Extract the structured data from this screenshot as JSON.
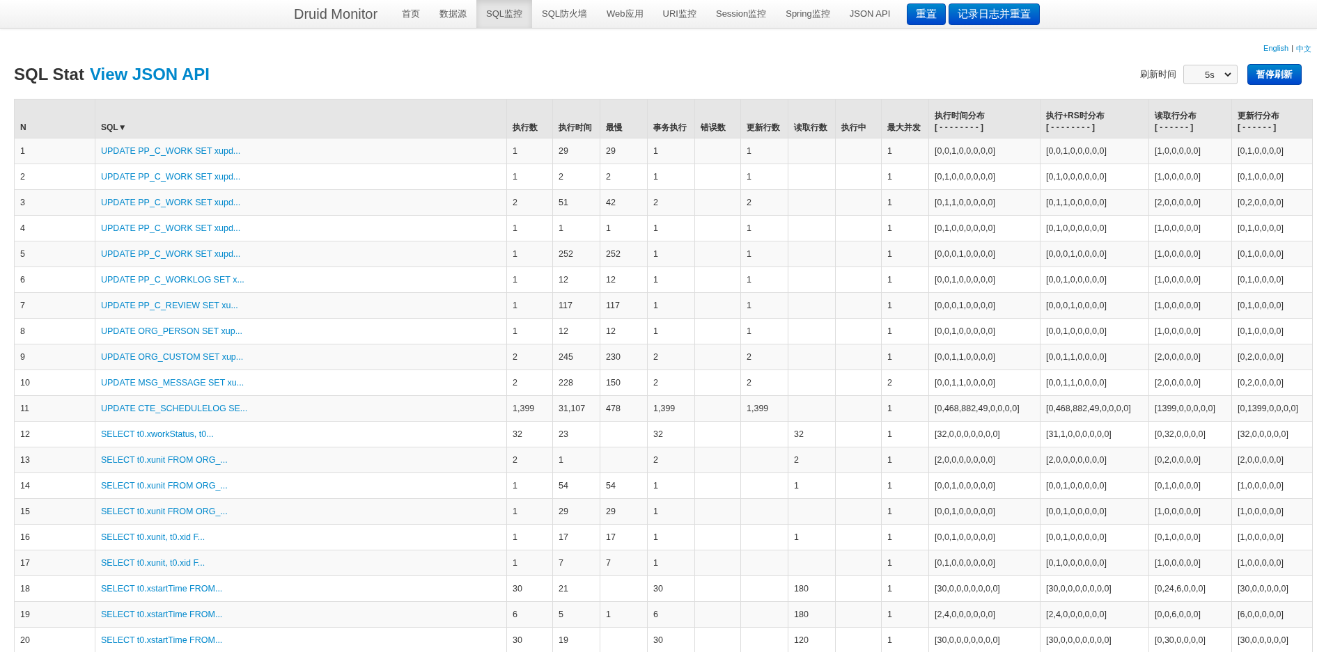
{
  "navbar": {
    "brand": "Druid Monitor",
    "items": [
      {
        "label": "首页",
        "selected": false
      },
      {
        "label": "数据源",
        "selected": false
      },
      {
        "label": "SQL监控",
        "selected": true
      },
      {
        "label": "SQL防火墙",
        "selected": false
      },
      {
        "label": "Web应用",
        "selected": false
      },
      {
        "label": "URI监控",
        "selected": false
      },
      {
        "label": "Session监控",
        "selected": false
      },
      {
        "label": "Spring监控",
        "selected": false
      },
      {
        "label": "JSON API",
        "selected": false
      }
    ],
    "buttons": [
      "重置",
      "记录日志并重置"
    ]
  },
  "languages": {
    "items": [
      "English",
      "中文"
    ],
    "separator": "|"
  },
  "title": {
    "text": "SQL Stat",
    "link": "View JSON API"
  },
  "refresh": {
    "label": "刷新时间",
    "value": "5s",
    "button": "暂停刷新"
  },
  "table": {
    "columns": [
      {
        "label": "N"
      },
      {
        "label": "SQL▼"
      },
      {
        "label": "执行数"
      },
      {
        "label": "执行时间"
      },
      {
        "label": "最慢"
      },
      {
        "label": "事务执行"
      },
      {
        "label": "错误数"
      },
      {
        "label": "更新行数"
      },
      {
        "label": "读取行数"
      },
      {
        "label": "执行中"
      },
      {
        "label": "最大并发"
      },
      {
        "label": "执行时间分布",
        "sub": "[ - - - - - - - - ]"
      },
      {
        "label": "执行+RS时分布",
        "sub": "[ - - - - - - - - ]"
      },
      {
        "label": "读取行分布",
        "sub": "[ - - - - - - ]"
      },
      {
        "label": "更新行分布",
        "sub": "[ - - - - - - ]"
      }
    ],
    "rows": [
      [
        "1",
        "UPDATE PP_C_WORK SET xupd...",
        "1",
        "29",
        "29",
        "1",
        null,
        "1",
        null,
        null,
        "1",
        "[0,0,1,0,0,0,0,0]",
        "[0,0,1,0,0,0,0,0]",
        "[1,0,0,0,0,0]",
        "[0,1,0,0,0,0]"
      ],
      [
        "2",
        "UPDATE PP_C_WORK SET xupd...",
        "1",
        "2",
        "2",
        "1",
        null,
        "1",
        null,
        null,
        "1",
        "[0,1,0,0,0,0,0,0]",
        "[0,1,0,0,0,0,0,0]",
        "[1,0,0,0,0,0]",
        "[0,1,0,0,0,0]"
      ],
      [
        "3",
        "UPDATE PP_C_WORK SET xupd...",
        "2",
        "51",
        "42",
        "2",
        null,
        "2",
        null,
        null,
        "1",
        "[0,1,1,0,0,0,0,0]",
        "[0,1,1,0,0,0,0,0]",
        "[2,0,0,0,0,0]",
        "[0,2,0,0,0,0]"
      ],
      [
        "4",
        "UPDATE PP_C_WORK SET xupd...",
        "1",
        "1",
        "1",
        "1",
        null,
        "1",
        null,
        null,
        "1",
        "[0,1,0,0,0,0,0,0]",
        "[0,1,0,0,0,0,0,0]",
        "[1,0,0,0,0,0]",
        "[0,1,0,0,0,0]"
      ],
      [
        "5",
        "UPDATE PP_C_WORK SET xupd...",
        "1",
        "252",
        "252",
        "1",
        null,
        "1",
        null,
        null,
        "1",
        "[0,0,0,1,0,0,0,0]",
        "[0,0,0,1,0,0,0,0]",
        "[1,0,0,0,0,0]",
        "[0,1,0,0,0,0]"
      ],
      [
        "6",
        "UPDATE PP_C_WORKLOG SET x...",
        "1",
        "12",
        "12",
        "1",
        null,
        "1",
        null,
        null,
        "1",
        "[0,0,1,0,0,0,0,0]",
        "[0,0,1,0,0,0,0,0]",
        "[1,0,0,0,0,0]",
        "[0,1,0,0,0,0]"
      ],
      [
        "7",
        "UPDATE PP_C_REVIEW SET xu...",
        "1",
        "117",
        "117",
        "1",
        null,
        "1",
        null,
        null,
        "1",
        "[0,0,0,1,0,0,0,0]",
        "[0,0,0,1,0,0,0,0]",
        "[1,0,0,0,0,0]",
        "[0,1,0,0,0,0]"
      ],
      [
        "8",
        "UPDATE ORG_PERSON SET xup...",
        "1",
        "12",
        "12",
        "1",
        null,
        "1",
        null,
        null,
        "1",
        "[0,0,1,0,0,0,0,0]",
        "[0,0,1,0,0,0,0,0]",
        "[1,0,0,0,0,0]",
        "[0,1,0,0,0,0]"
      ],
      [
        "9",
        "UPDATE ORG_CUSTOM SET xup...",
        "2",
        "245",
        "230",
        "2",
        null,
        "2",
        null,
        null,
        "1",
        "[0,0,1,1,0,0,0,0]",
        "[0,0,1,1,0,0,0,0]",
        "[2,0,0,0,0,0]",
        "[0,2,0,0,0,0]"
      ],
      [
        "10",
        "UPDATE MSG_MESSAGE SET xu...",
        "2",
        "228",
        "150",
        "2",
        null,
        "2",
        null,
        null,
        "2",
        "[0,0,1,1,0,0,0,0]",
        "[0,0,1,1,0,0,0,0]",
        "[2,0,0,0,0,0]",
        "[0,2,0,0,0,0]"
      ],
      [
        "11",
        "UPDATE CTE_SCHEDULELOG SE...",
        "1,399",
        "31,107",
        "478",
        "1,399",
        null,
        "1,399",
        null,
        null,
        "1",
        "[0,468,882,49,0,0,0,0]",
        "[0,468,882,49,0,0,0,0]",
        "[1399,0,0,0,0,0]",
        "[0,1399,0,0,0,0]"
      ],
      [
        "12",
        "SELECT t0.xworkStatus, t0...",
        "32",
        "23",
        null,
        "32",
        null,
        null,
        "32",
        null,
        "1",
        "[32,0,0,0,0,0,0,0]",
        "[31,1,0,0,0,0,0,0]",
        "[0,32,0,0,0,0]",
        "[32,0,0,0,0,0]"
      ],
      [
        "13",
        "SELECT t0.xunit FROM ORG_...",
        "2",
        "1",
        null,
        "2",
        null,
        null,
        "2",
        null,
        "1",
        "[2,0,0,0,0,0,0,0]",
        "[2,0,0,0,0,0,0,0]",
        "[0,2,0,0,0,0]",
        "[2,0,0,0,0,0]"
      ],
      [
        "14",
        "SELECT t0.xunit FROM ORG_...",
        "1",
        "54",
        "54",
        "1",
        null,
        null,
        "1",
        null,
        "1",
        "[0,0,1,0,0,0,0,0]",
        "[0,0,1,0,0,0,0,0]",
        "[0,1,0,0,0,0]",
        "[1,0,0,0,0,0]"
      ],
      [
        "15",
        "SELECT t0.xunit FROM ORG_...",
        "1",
        "29",
        "29",
        "1",
        null,
        null,
        null,
        null,
        "1",
        "[0,0,1,0,0,0,0,0]",
        "[0,0,1,0,0,0,0,0]",
        "[1,0,0,0,0,0]",
        "[1,0,0,0,0,0]"
      ],
      [
        "16",
        "SELECT t0.xunit, t0.xid F...",
        "1",
        "17",
        "17",
        "1",
        null,
        null,
        "1",
        null,
        "1",
        "[0,0,1,0,0,0,0,0]",
        "[0,0,1,0,0,0,0,0]",
        "[0,1,0,0,0,0]",
        "[1,0,0,0,0,0]"
      ],
      [
        "17",
        "SELECT t0.xunit, t0.xid F...",
        "1",
        "7",
        "7",
        "1",
        null,
        null,
        null,
        null,
        "1",
        "[0,1,0,0,0,0,0,0]",
        "[0,1,0,0,0,0,0,0]",
        "[1,0,0,0,0,0]",
        "[1,0,0,0,0,0]"
      ],
      [
        "18",
        "SELECT t0.xstartTime FROM...",
        "30",
        "21",
        null,
        "30",
        null,
        null,
        "180",
        null,
        "1",
        "[30,0,0,0,0,0,0,0]",
        "[30,0,0,0,0,0,0,0]",
        "[0,24,6,0,0,0]",
        "[30,0,0,0,0,0]"
      ],
      [
        "19",
        "SELECT t0.xstartTime FROM...",
        "6",
        "5",
        "1",
        "6",
        null,
        null,
        "180",
        null,
        "1",
        "[2,4,0,0,0,0,0,0]",
        "[2,4,0,0,0,0,0,0]",
        "[0,0,6,0,0,0]",
        "[6,0,0,0,0,0]"
      ],
      [
        "20",
        "SELECT t0.xstartTime FROM...",
        "30",
        "19",
        null,
        "30",
        null,
        null,
        "120",
        null,
        "1",
        "[30,0,0,0,0,0,0,0]",
        "[30,0,0,0,0,0,0,0]",
        "[0,30,0,0,0,0]",
        "[30,0,0,0,0,0]"
      ]
    ]
  }
}
